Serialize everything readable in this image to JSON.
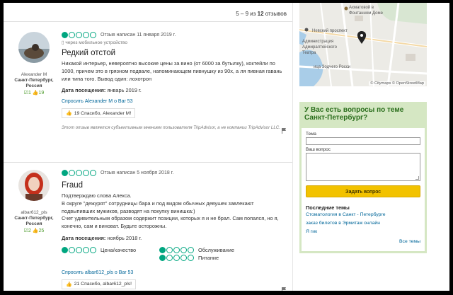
{
  "counter": {
    "range": "5 – 9",
    "of": "из",
    "total": "12",
    "suffix": "отзывов"
  },
  "reviews": [
    {
      "user": {
        "name": "Alexander M",
        "location": "Санкт-Петербург, Россия",
        "reviews_count": "1",
        "thanks_count": "19"
      },
      "rating": 1,
      "date": "Отзыв написан 11 января 2019 г.",
      "via": "через мобильное устройство",
      "title": "Редкий отстой",
      "text": "Никакой интерьер, невероятно высокие цены за вино (от 6000 за бутылку), коктейли по 1000, причем это в грязном подвале, напоминающем пивнушку из 90х, а ля пивная гавань или типа того. Вывод один: лохотрон",
      "visit_label": "Дата посещения:",
      "visit_value": "январь 2019 г.",
      "ask": "Спросить Alexander M о Bar 53",
      "thanks": "19  Спасибо, Alexander M!",
      "disclaimer": "Этот отзыв является субъективным мнением пользователя TripAdvisor, а не компании TripAdvisor LLC."
    },
    {
      "user": {
        "name": "albar612_pls",
        "location": "Санкт-Петербург, Россия",
        "reviews_count": "2",
        "thanks_count": "25"
      },
      "rating": 1,
      "date": "Отзыв написан 5 ноября 2018 г.",
      "title": "Fraud",
      "text_lines": [
        "Подтверждаю слова Алекса.",
        "В округе \"дежурят\" сотрудницы бара и под видом обычных девушек завлекают подвыпивших мужиков, разводят на покупку винишка:)",
        "Счет удивительным образом содержит позиции, которых я и не брал. Сам попался, но я, конечно, сам и виноват. Будьте осторожны."
      ],
      "visit_label": "Дата посещения:",
      "visit_value": "ноябрь 2018 г.",
      "subratings": [
        {
          "label": "Цена/качество",
          "rating": 1
        },
        {
          "label": "Обслуживание",
          "rating": 1
        },
        {
          "label": "",
          "rating": 0
        },
        {
          "label": "Питание",
          "rating": 1
        }
      ],
      "ask": "Спросить albar612_pls о Bar 53",
      "thanks": "21  Спасибо, albar612_pls!"
    }
  ],
  "map": {
    "labels": [
      "Ахматовой в",
      "Фонтанном Доме",
      "Невский проспект",
      "Администрация",
      "Адмиралтейского",
      "Театра",
      "ица Зодчего Росси"
    ],
    "attribution": "© Citymaps  © OpenStreetMap"
  },
  "qa": {
    "title": "У Вас есть вопросы по теме Санкт-Петербург?",
    "topic_label": "Тема",
    "question_label": "Ваш вопрос",
    "button": "Задать вопрос",
    "latest_title": "Последние темы",
    "topics": [
      "Стоматология в Санкт - Петербурге",
      "заказ билетов в Эрмитаж онлайн",
      "Я гик"
    ],
    "all_topics": "Все темы"
  },
  "colors": {
    "bubble": "#00a680",
    "link": "#006699",
    "qa_border": "#d5e7c3",
    "qa_title": "#2a6e1c",
    "button": "#f2c200"
  }
}
